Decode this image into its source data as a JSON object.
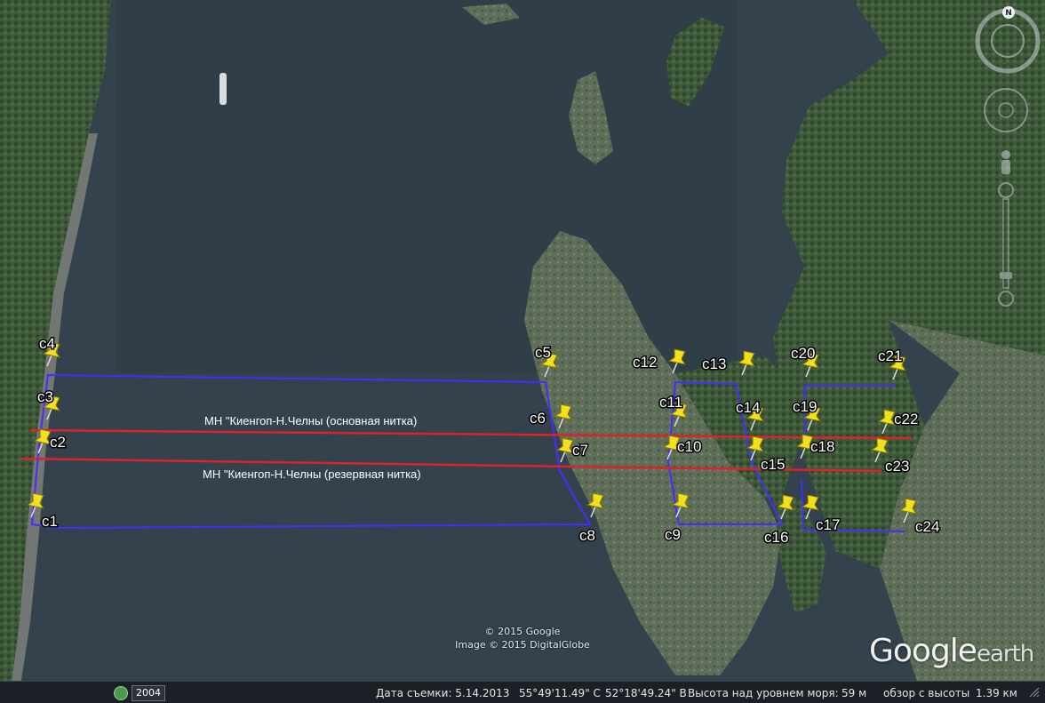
{
  "placemarks": [
    {
      "label": "c1"
    },
    {
      "label": "c2"
    },
    {
      "label": "c3"
    },
    {
      "label": "c4"
    },
    {
      "label": "c5"
    },
    {
      "label": "c6"
    },
    {
      "label": "c7"
    },
    {
      "label": "c8"
    },
    {
      "label": "c9"
    },
    {
      "label": "c10"
    },
    {
      "label": "c11"
    },
    {
      "label": "c12"
    },
    {
      "label": "c13"
    },
    {
      "label": "c14"
    },
    {
      "label": "c15"
    },
    {
      "label": "c16"
    },
    {
      "label": "c17"
    },
    {
      "label": "c18"
    },
    {
      "label": "c19"
    },
    {
      "label": "c20"
    },
    {
      "label": "c21"
    },
    {
      "label": "c22"
    },
    {
      "label": "c23"
    },
    {
      "label": "c24"
    }
  ],
  "pipelines": {
    "main_label": "МН \"Киенгоп-Н.Челны (основная нитка)",
    "reserve_label": "МН \"Киенгоп-Н.Челны (резервная нитка)",
    "color": "#e0202a"
  },
  "boundary_color": "#4a2bff",
  "copyright": {
    "google": "© 2015 Google",
    "image": "Image © 2015 DigitalGlobe"
  },
  "logo": {
    "brand": "Google",
    "product": "earth"
  },
  "compass": {
    "north": "N"
  },
  "statusbar": {
    "year": "2004",
    "date": "Дата съемки: 5.14.2013",
    "lat": "55°49'11.49\" С",
    "lon": "52°18'49.24\" В",
    "elev_label": "Высота над уровнем моря:",
    "elev_value": "59 м",
    "eye_label": "обзор с высоты",
    "eye_value": "1.39 км"
  },
  "colors": {
    "water": "#34424d",
    "forest": "#3f5a3c",
    "pin": "#f2e01c"
  }
}
